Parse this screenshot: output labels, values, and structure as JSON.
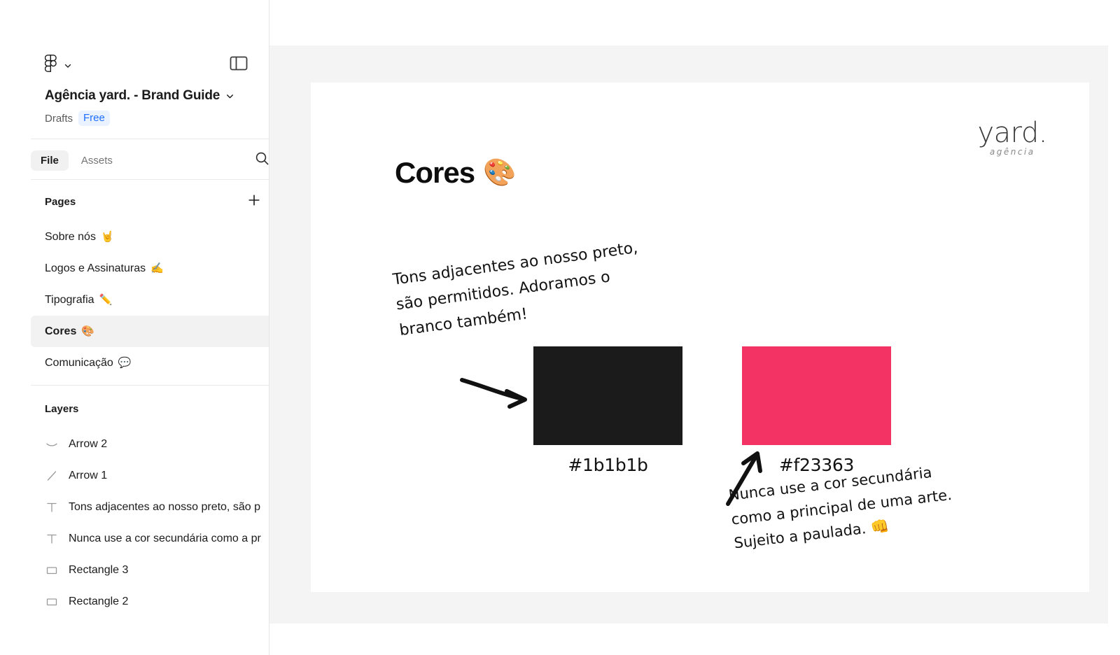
{
  "app": {
    "name": "Figma",
    "logo_icon": "figma-logo-icon",
    "menu_chevron_icon": "chevron-down-icon",
    "panel_toggle_icon": "panel-layout-icon"
  },
  "file": {
    "title": "Agência yard. - Brand Guide",
    "title_chevron_icon": "chevron-down-icon",
    "location": "Drafts",
    "plan_badge": "Free"
  },
  "tabs": {
    "items": [
      {
        "label": "File",
        "active": true
      },
      {
        "label": "Assets",
        "active": false
      }
    ],
    "search_icon": "search-icon"
  },
  "pages": {
    "heading": "Pages",
    "add_icon": "plus-icon",
    "items": [
      {
        "label": "Sobre nós",
        "emoji": "🤘",
        "selected": false
      },
      {
        "label": "Logos e Assinaturas",
        "emoji": "✍️",
        "selected": false
      },
      {
        "label": "Tipografia",
        "emoji": "✏️",
        "selected": false
      },
      {
        "label": "Cores",
        "emoji": "🎨",
        "selected": true
      },
      {
        "label": "Comunicação",
        "emoji": "💬",
        "selected": false
      }
    ]
  },
  "layers": {
    "heading": "Layers",
    "items": [
      {
        "label": "Arrow 2",
        "icon": "curve-line-icon"
      },
      {
        "label": "Arrow 1",
        "icon": "diagonal-line-icon"
      },
      {
        "label": "Tons adjacentes ao nosso preto, são p",
        "icon": "text-layer-icon"
      },
      {
        "label": "Nunca use a cor secundária como a pr",
        "icon": "text-layer-icon"
      },
      {
        "label": "Rectangle 3",
        "icon": "rectangle-icon"
      },
      {
        "label": "Rectangle 2",
        "icon": "rectangle-icon"
      }
    ]
  },
  "artboard": {
    "title": "Cores",
    "title_emoji": "🎨",
    "brand": {
      "wordmark": "yard.",
      "tagline": "agência"
    },
    "note_left": "Tons adjacentes ao nosso preto,\nsão permitidos. Adoramos o\nbranco também!",
    "note_right": "Nunca use a cor secundária\ncomo a principal de uma arte.\nSujeito a paulada. 👊",
    "swatches": [
      {
        "name": "preto",
        "hex": "#1b1b1b",
        "label": "#1b1b1b"
      },
      {
        "name": "secundária",
        "hex": "#f23363",
        "label": "#f23363"
      }
    ],
    "arrows": [
      {
        "name": "arrow-right",
        "direction": "right"
      },
      {
        "name": "arrow-up-right",
        "direction": "up-right"
      }
    ]
  },
  "colors": {
    "canvas_bg": "#f4f4f4",
    "frame_bg": "#ffffff",
    "accent_blue": "#1f6fff",
    "selected_row_bg": "#f2f2f2",
    "primary_dark": "#1b1b1b",
    "secondary_pink": "#f23363"
  }
}
